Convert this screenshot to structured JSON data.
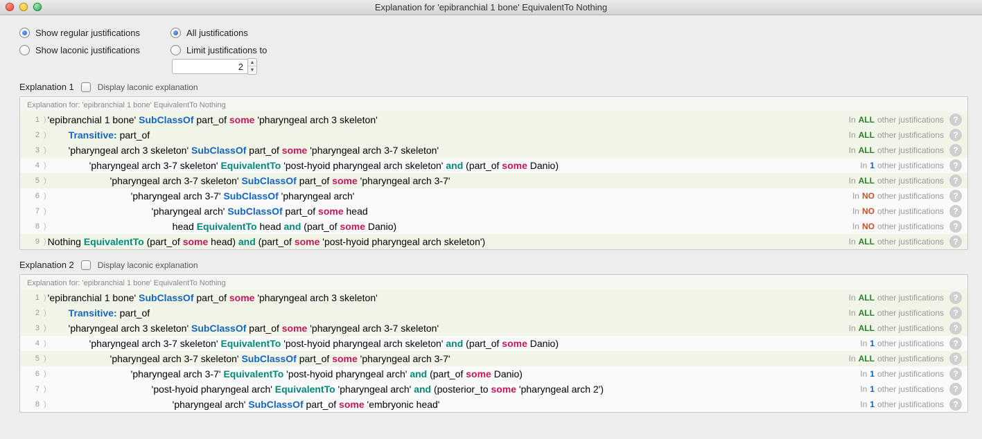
{
  "window": {
    "title": "Explanation for 'epibranchial 1 bone' EquivalentTo Nothing"
  },
  "radios": {
    "regular": "Show regular justifications",
    "laconic": "Show laconic justifications",
    "all": "All justifications",
    "limit": "Limit justifications to",
    "limit_value": "2"
  },
  "laconic_check_label": "Display laconic explanation",
  "explanation_for_label": "Explanation for: 'epibranchial 1 bone' EquivalentTo Nothing",
  "justif_prefix": "In",
  "justif_suffix": "other justifications",
  "help_glyph": "?",
  "explanations": [
    {
      "title": "Explanation 1",
      "rows": [
        {
          "n": 1,
          "indent": 0,
          "hl": true,
          "count": "ALL",
          "tokens": [
            [
              "plain",
              "'epibranchial 1 bone' "
            ],
            [
              "kw-sub",
              "SubClassOf"
            ],
            [
              "plain",
              " part_of "
            ],
            [
              "kw-some",
              "some"
            ],
            [
              "plain",
              " 'pharyngeal arch 3 skeleton'"
            ]
          ]
        },
        {
          "n": 2,
          "indent": 1,
          "hl": true,
          "count": "ALL",
          "tokens": [
            [
              "kw-trans",
              "Transitive:"
            ],
            [
              "plain",
              " part_of"
            ]
          ]
        },
        {
          "n": 3,
          "indent": 1,
          "hl": true,
          "count": "ALL",
          "tokens": [
            [
              "plain",
              "'pharyngeal arch 3 skeleton' "
            ],
            [
              "kw-sub",
              "SubClassOf"
            ],
            [
              "plain",
              " part_of "
            ],
            [
              "kw-some",
              "some"
            ],
            [
              "plain",
              " 'pharyngeal arch 3-7 skeleton'"
            ]
          ]
        },
        {
          "n": 4,
          "indent": 2,
          "hl": false,
          "count": "1",
          "tokens": [
            [
              "plain",
              "'pharyngeal arch 3-7 skeleton' "
            ],
            [
              "kw-eq",
              "EquivalentTo"
            ],
            [
              "plain",
              " 'post-hyoid pharyngeal arch skeleton' "
            ],
            [
              "kw-and",
              "and"
            ],
            [
              "plain",
              " (part_of "
            ],
            [
              "kw-some",
              "some"
            ],
            [
              "plain",
              " Danio)"
            ]
          ]
        },
        {
          "n": 5,
          "indent": 3,
          "hl": true,
          "count": "ALL",
          "tokens": [
            [
              "plain",
              "'pharyngeal arch 3-7 skeleton' "
            ],
            [
              "kw-sub",
              "SubClassOf"
            ],
            [
              "plain",
              " part_of "
            ],
            [
              "kw-some",
              "some"
            ],
            [
              "plain",
              " 'pharyngeal arch 3-7'"
            ]
          ]
        },
        {
          "n": 6,
          "indent": 4,
          "hl": false,
          "count": "NO",
          "tokens": [
            [
              "plain",
              "'pharyngeal arch 3-7' "
            ],
            [
              "kw-sub",
              "SubClassOf"
            ],
            [
              "plain",
              " 'pharyngeal arch'"
            ]
          ]
        },
        {
          "n": 7,
          "indent": 5,
          "hl": false,
          "count": "NO",
          "tokens": [
            [
              "plain",
              "'pharyngeal arch' "
            ],
            [
              "kw-sub",
              "SubClassOf"
            ],
            [
              "plain",
              " part_of "
            ],
            [
              "kw-some",
              "some"
            ],
            [
              "plain",
              " head"
            ]
          ]
        },
        {
          "n": 8,
          "indent": 6,
          "hl": false,
          "count": "NO",
          "tokens": [
            [
              "plain",
              "head "
            ],
            [
              "kw-eq",
              "EquivalentTo"
            ],
            [
              "plain",
              " head "
            ],
            [
              "kw-and",
              "and"
            ],
            [
              "plain",
              " (part_of "
            ],
            [
              "kw-some",
              "some"
            ],
            [
              "plain",
              " Danio)"
            ]
          ]
        },
        {
          "n": 9,
          "indent": 0,
          "hl": true,
          "count": "ALL",
          "tokens": [
            [
              "plain",
              "Nothing "
            ],
            [
              "kw-eq",
              "EquivalentTo"
            ],
            [
              "plain",
              " (part_of "
            ],
            [
              "kw-some",
              "some"
            ],
            [
              "plain",
              " head) "
            ],
            [
              "kw-and",
              "and"
            ],
            [
              "plain",
              " (part_of "
            ],
            [
              "kw-some",
              "some"
            ],
            [
              "plain",
              " 'post-hyoid pharyngeal arch skeleton')"
            ]
          ]
        }
      ]
    },
    {
      "title": "Explanation 2",
      "rows": [
        {
          "n": 1,
          "indent": 0,
          "hl": true,
          "count": "ALL",
          "tokens": [
            [
              "plain",
              "'epibranchial 1 bone' "
            ],
            [
              "kw-sub",
              "SubClassOf"
            ],
            [
              "plain",
              " part_of "
            ],
            [
              "kw-some",
              "some"
            ],
            [
              "plain",
              " 'pharyngeal arch 3 skeleton'"
            ]
          ]
        },
        {
          "n": 2,
          "indent": 1,
          "hl": true,
          "count": "ALL",
          "tokens": [
            [
              "kw-trans",
              "Transitive:"
            ],
            [
              "plain",
              " part_of"
            ]
          ]
        },
        {
          "n": 3,
          "indent": 1,
          "hl": true,
          "count": "ALL",
          "tokens": [
            [
              "plain",
              "'pharyngeal arch 3 skeleton' "
            ],
            [
              "kw-sub",
              "SubClassOf"
            ],
            [
              "plain",
              " part_of "
            ],
            [
              "kw-some",
              "some"
            ],
            [
              "plain",
              " 'pharyngeal arch 3-7 skeleton'"
            ]
          ]
        },
        {
          "n": 4,
          "indent": 2,
          "hl": false,
          "count": "1",
          "tokens": [
            [
              "plain",
              "'pharyngeal arch 3-7 skeleton' "
            ],
            [
              "kw-eq",
              "EquivalentTo"
            ],
            [
              "plain",
              " 'post-hyoid pharyngeal arch skeleton' "
            ],
            [
              "kw-and",
              "and"
            ],
            [
              "plain",
              " (part_of "
            ],
            [
              "kw-some",
              "some"
            ],
            [
              "plain",
              " Danio)"
            ]
          ]
        },
        {
          "n": 5,
          "indent": 3,
          "hl": true,
          "count": "ALL",
          "tokens": [
            [
              "plain",
              "'pharyngeal arch 3-7 skeleton' "
            ],
            [
              "kw-sub",
              "SubClassOf"
            ],
            [
              "plain",
              " part_of "
            ],
            [
              "kw-some",
              "some"
            ],
            [
              "plain",
              " 'pharyngeal arch 3-7'"
            ]
          ]
        },
        {
          "n": 6,
          "indent": 4,
          "hl": false,
          "count": "1",
          "tokens": [
            [
              "plain",
              "'pharyngeal arch 3-7' "
            ],
            [
              "kw-eq",
              "EquivalentTo"
            ],
            [
              "plain",
              " 'post-hyoid pharyngeal arch' "
            ],
            [
              "kw-and",
              "and"
            ],
            [
              "plain",
              " (part_of "
            ],
            [
              "kw-some",
              "some"
            ],
            [
              "plain",
              " Danio)"
            ]
          ]
        },
        {
          "n": 7,
          "indent": 5,
          "hl": false,
          "count": "1",
          "tokens": [
            [
              "plain",
              "'post-hyoid pharyngeal arch' "
            ],
            [
              "kw-eq",
              "EquivalentTo"
            ],
            [
              "plain",
              " 'pharyngeal arch' "
            ],
            [
              "kw-and",
              "and"
            ],
            [
              "plain",
              " (posterior_to "
            ],
            [
              "kw-some",
              "some"
            ],
            [
              "plain",
              " 'pharyngeal arch 2')"
            ]
          ]
        },
        {
          "n": 8,
          "indent": 6,
          "hl": false,
          "count": "1",
          "tokens": [
            [
              "plain",
              "'pharyngeal arch' "
            ],
            [
              "kw-sub",
              "SubClassOf"
            ],
            [
              "plain",
              " part_of "
            ],
            [
              "kw-some",
              "some"
            ],
            [
              "plain",
              " 'embryonic head'"
            ]
          ]
        }
      ]
    }
  ]
}
